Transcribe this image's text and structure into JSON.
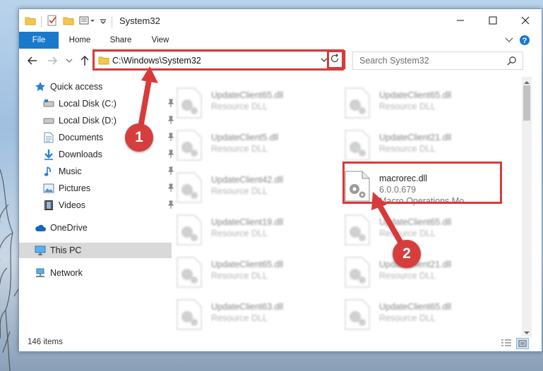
{
  "window": {
    "title": "System32"
  },
  "ribbon": {
    "tabs": [
      {
        "label": "File"
      },
      {
        "label": "Home"
      },
      {
        "label": "Share"
      },
      {
        "label": "View"
      }
    ]
  },
  "address": {
    "path": "C:\\Windows\\System32"
  },
  "search": {
    "placeholder": "Search System32"
  },
  "sidebar": {
    "items": [
      {
        "label": "Quick access"
      },
      {
        "label": "Local Disk (C:)"
      },
      {
        "label": "Local Disk (D:)"
      },
      {
        "label": "Documents"
      },
      {
        "label": "Downloads"
      },
      {
        "label": "Music"
      },
      {
        "label": "Pictures"
      },
      {
        "label": "Videos"
      },
      {
        "label": "OneDrive"
      },
      {
        "label": "This PC"
      },
      {
        "label": "Network"
      }
    ]
  },
  "files": {
    "left": [
      {
        "name": "UpdateClient65.dll",
        "type": "Resource DLL"
      },
      {
        "name": "UpdateClient5.dll",
        "type": "Resource DLL"
      },
      {
        "name": "UpdateClient42.dll",
        "type": "Resource DLL"
      },
      {
        "name": "UpdateClient19.dll",
        "type": "Resource DLL"
      },
      {
        "name": "UpdateClient65.dll",
        "type": "Resource DLL"
      },
      {
        "name": "UpdateClient63.dll",
        "type": "Resource DLL"
      }
    ],
    "right": [
      {
        "name": "UpdateClient65.dll",
        "type": "Resource DLL"
      },
      {
        "name": "UpdateClient21.dll",
        "type": "Resource DLL"
      },
      {
        "name": "UpdateClient65.dll",
        "type": "Resource DLL"
      },
      {
        "name": "UpdateClient21.dll",
        "type": "Resource DLL"
      },
      {
        "name": "UpdateClient65.dll",
        "type": "Resource DLL"
      }
    ],
    "target": {
      "name": "macrorec.dll",
      "version": "6.0.0.679",
      "description": "Macro Operations Mo..."
    }
  },
  "status": {
    "item_count": "146 items"
  },
  "annotations": {
    "step1": "1",
    "step2": "2",
    "color": "#d83a3a"
  }
}
